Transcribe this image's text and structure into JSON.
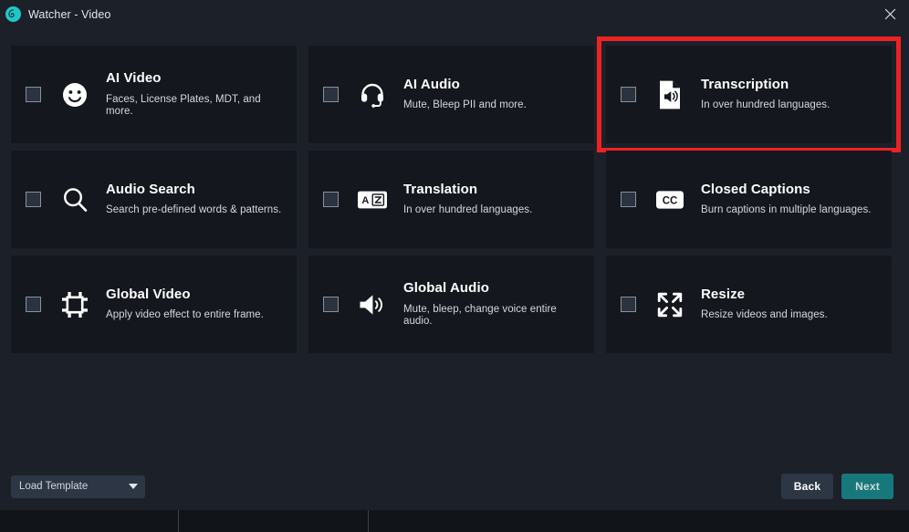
{
  "window": {
    "title": "Watcher - Video",
    "logo_icon": "watcher-spiral-icon",
    "close_icon": "close-icon"
  },
  "colors": {
    "background": "#1c2029",
    "card": "#14171d",
    "highlight": "#ee2222",
    "accent": "#17787c",
    "logo": "#1fc8c8"
  },
  "cards": [
    {
      "id": "ai-video",
      "title": "AI Video",
      "subtitle": "Faces, License Plates, MDT, and more.",
      "icon": "smiley-face-icon",
      "checked": false,
      "highlighted": false
    },
    {
      "id": "ai-audio",
      "title": "AI Audio",
      "subtitle": "Mute, Bleep PII and more.",
      "icon": "headset-icon",
      "checked": false,
      "highlighted": false
    },
    {
      "id": "transcription",
      "title": "Transcription",
      "subtitle": "In over hundred languages.",
      "icon": "document-audio-icon",
      "checked": false,
      "highlighted": true
    },
    {
      "id": "audio-search",
      "title": "Audio Search",
      "subtitle": "Search pre-defined words & patterns.",
      "icon": "search-icon",
      "checked": false,
      "highlighted": false
    },
    {
      "id": "translation",
      "title": "Translation",
      "subtitle": "In over hundred languages.",
      "icon": "translate-icon",
      "checked": false,
      "highlighted": false
    },
    {
      "id": "closed-captions",
      "title": "Closed Captions",
      "subtitle": "Burn captions in multiple languages.",
      "icon": "cc-icon",
      "checked": false,
      "highlighted": false
    },
    {
      "id": "global-video",
      "title": "Global Video",
      "subtitle": "Apply video effect to entire frame.",
      "icon": "frame-crop-icon",
      "checked": false,
      "highlighted": false
    },
    {
      "id": "global-audio",
      "title": "Global Audio",
      "subtitle": "Mute, bleep, change voice entire audio.",
      "icon": "speaker-icon",
      "checked": false,
      "highlighted": false
    },
    {
      "id": "resize",
      "title": "Resize",
      "subtitle": "Resize videos and images.",
      "icon": "expand-arrows-icon",
      "checked": false,
      "highlighted": false
    }
  ],
  "footer": {
    "template_select_label": "Load Template",
    "template_caret_icon": "chevron-down-icon",
    "back_label": "Back",
    "next_label": "Next"
  }
}
